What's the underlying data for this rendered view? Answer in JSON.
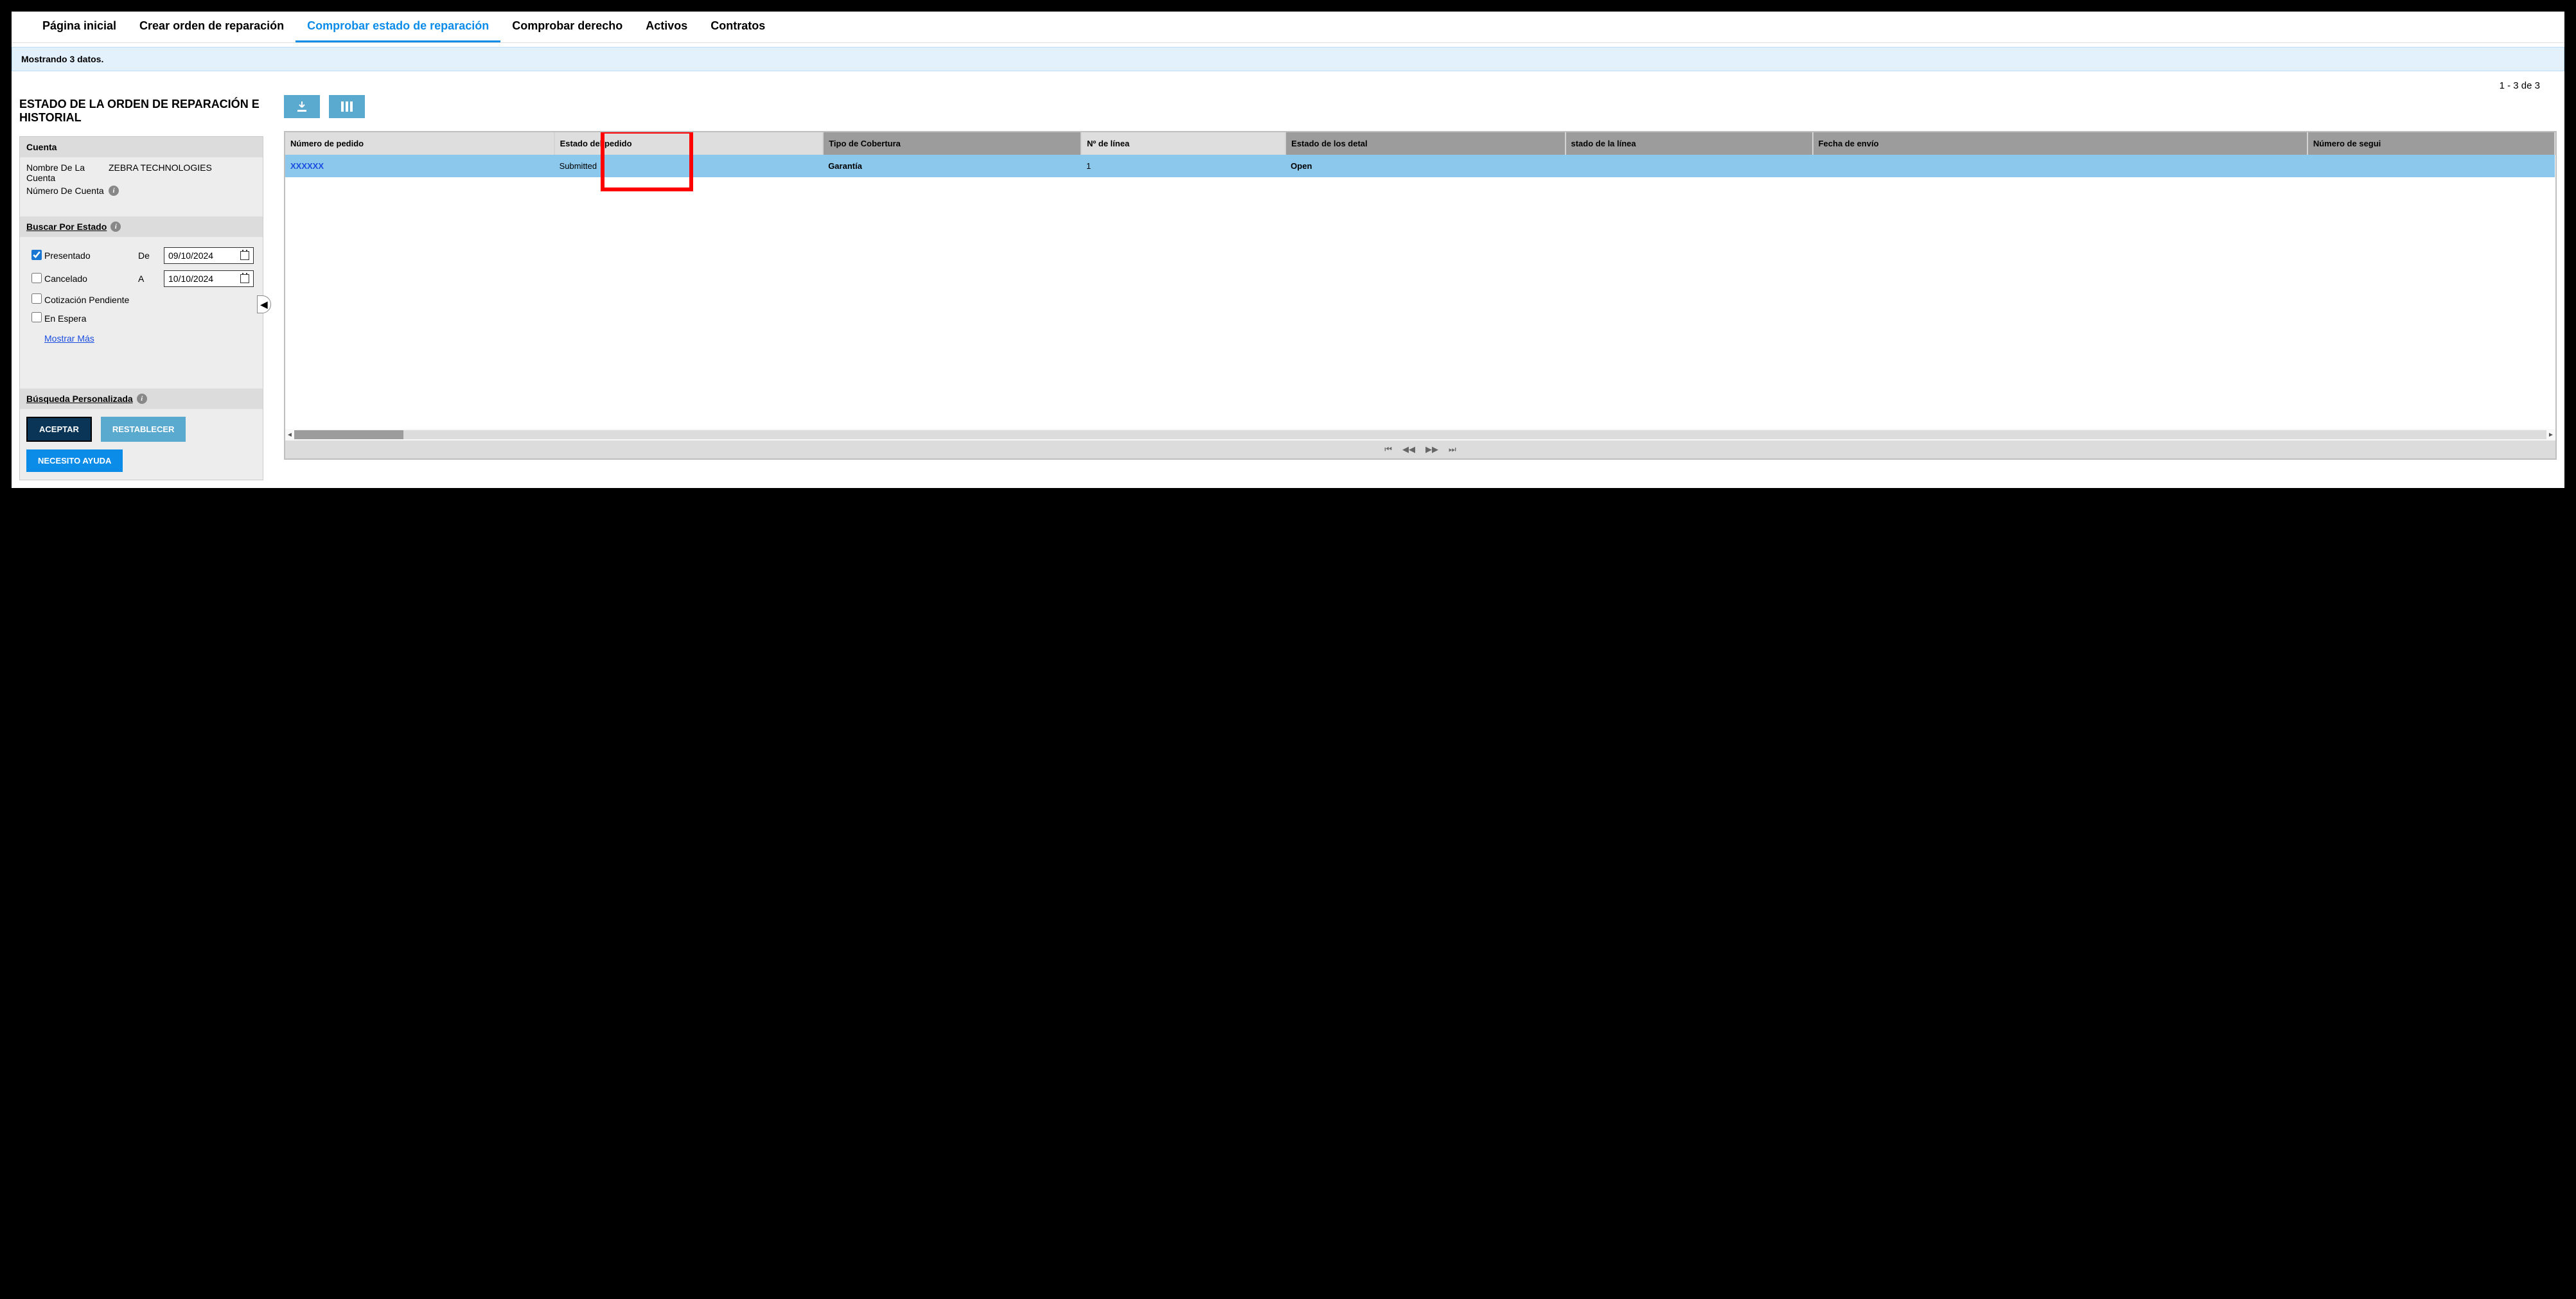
{
  "tabs": {
    "home": "Página inicial",
    "create": "Crear orden de reparación",
    "check": "Comprobar estado de reparación",
    "entitlement": "Comprobar derecho",
    "assets": "Activos",
    "contracts": "Contratos"
  },
  "banner": "Mostrando 3 datos.",
  "pagecount": "1 - 3 de 3",
  "section_title": "ESTADO DE LA ORDEN DE REPARACIÓN E HISTORIAL",
  "account": {
    "header": "Cuenta",
    "name_label": "Nombre De La Cuenta",
    "name_value": "ZEBRA TECHNOLOGIES",
    "number_label": "Número De Cuenta"
  },
  "search_status": {
    "header": "Buscar Por Estado",
    "from_label": "De",
    "to_label": "A",
    "from_date": "09/10/2024",
    "to_date": "10/10/2024",
    "opts": {
      "submitted": "Presentado",
      "cancelled": "Cancelado",
      "pending_quote": "Cotización Pendiente",
      "on_hold": "En Espera"
    },
    "show_more": "Mostrar Más"
  },
  "custom_search": "Búsqueda Personalizada",
  "buttons": {
    "accept": "ACEPTAR",
    "reset": "RESTABLECER",
    "help": "NECESITO AYUDA"
  },
  "table": {
    "headers": {
      "order_no": "Número de pedido",
      "order_status": "Estado del pedido",
      "coverage": "Tipo de Cobertura",
      "line_no": "Nº de línea",
      "detail_status": "Estado de los detal",
      "line_status": "stado de la línea",
      "ship_date": "Fecha de envío",
      "tracking": "Número de segui"
    },
    "row": {
      "order_no": "XXXXXX",
      "order_status": "Submitted",
      "coverage": "Garantía",
      "line_no": "1",
      "detail_status": "Open",
      "line_status": "",
      "ship_date": "",
      "tracking": ""
    }
  }
}
